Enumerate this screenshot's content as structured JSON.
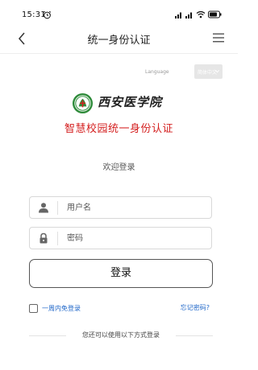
{
  "status_bar": {
    "time": "15:31",
    "icons": [
      "alarm-icon",
      "signal-icon",
      "signal-icon",
      "wifi-icon",
      "battery-icon"
    ]
  },
  "header": {
    "title": "统一身份认证",
    "back_icon": "chevron-left-icon",
    "menu_icon": "hamburger-menu-icon"
  },
  "language": {
    "label": "Language",
    "selected": "简体中文"
  },
  "logo": {
    "emblem_icon": "school-emblem-icon",
    "school_name": "西安医学院"
  },
  "subtitle": "智慧校园统一身份认证",
  "welcome": "欢迎登录",
  "form": {
    "username_placeholder": "用户名",
    "password_placeholder": "密码",
    "login_label": "登录",
    "remember_label": "一周内免登录",
    "forgot_label": "忘记密码?"
  },
  "alt_login": "您还可以使用以下方式登录",
  "colors": {
    "accent_red": "#d41f1f",
    "link_blue": "#1e66c8",
    "emblem_green": "#2e8b3a"
  }
}
